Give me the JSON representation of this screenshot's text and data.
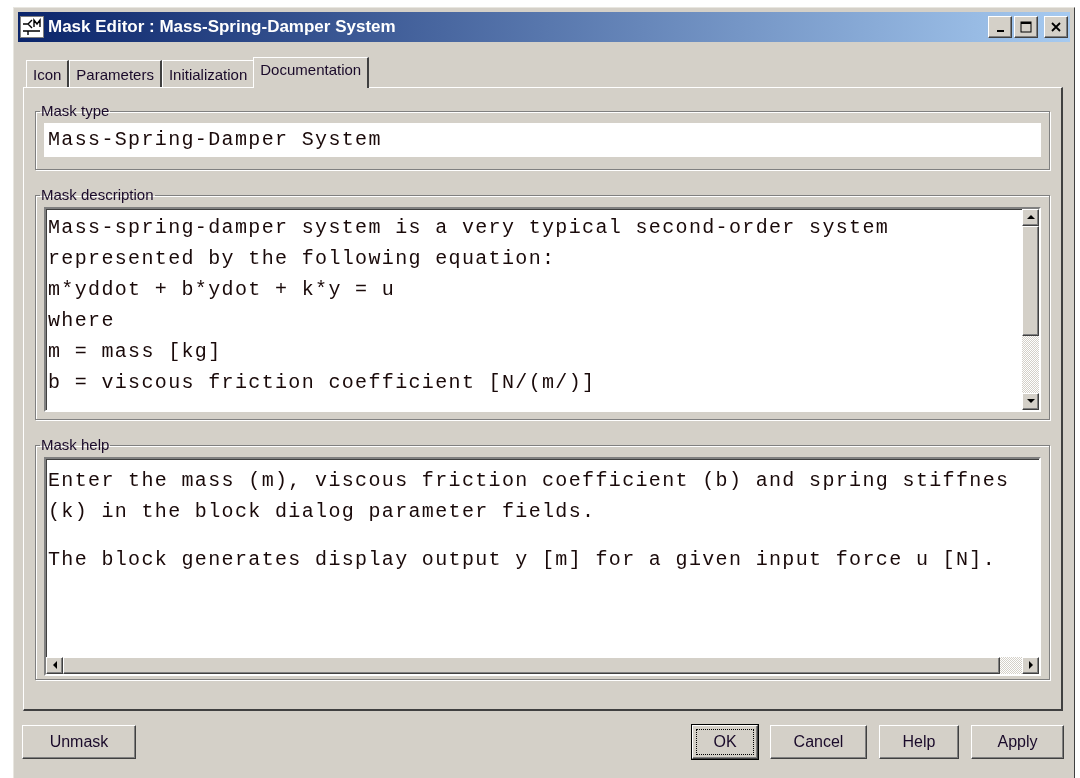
{
  "window": {
    "title": "Mask Editor : Mass-Spring-Damper System"
  },
  "tabs": [
    {
      "label": "Icon",
      "selected": false
    },
    {
      "label": "Parameters",
      "selected": false
    },
    {
      "label": "Initialization",
      "selected": false
    },
    {
      "label": "Documentation",
      "selected": true
    }
  ],
  "mask_type": {
    "label": "Mask type",
    "value": "Mass-Spring-Damper System"
  },
  "mask_description": {
    "label": "Mask description",
    "lines": [
      "Mass-spring-damper system is a very typical second-order system",
      "represented by the following equation:",
      "m*yddot + b*ydot + k*y = u",
      "where",
      "m = mass [kg]",
      "b = viscous friction coefficient [N/(m/)]"
    ]
  },
  "mask_help": {
    "label": "Mask help",
    "paragraphs": [
      [
        "Enter the mass (m), viscous friction coefficient (b) and spring stiffnes",
        "(k) in the block dialog parameter fields."
      ],
      [
        "The block generates display output y [m] for a given input force u [N]."
      ]
    ]
  },
  "buttons_left": [
    {
      "label": "Unmask",
      "default": false
    }
  ],
  "buttons_right": [
    {
      "label": "OK",
      "default": true
    },
    {
      "label": "Cancel",
      "default": false
    },
    {
      "label": "Help",
      "default": false
    },
    {
      "label": "Apply",
      "default": false
    }
  ]
}
